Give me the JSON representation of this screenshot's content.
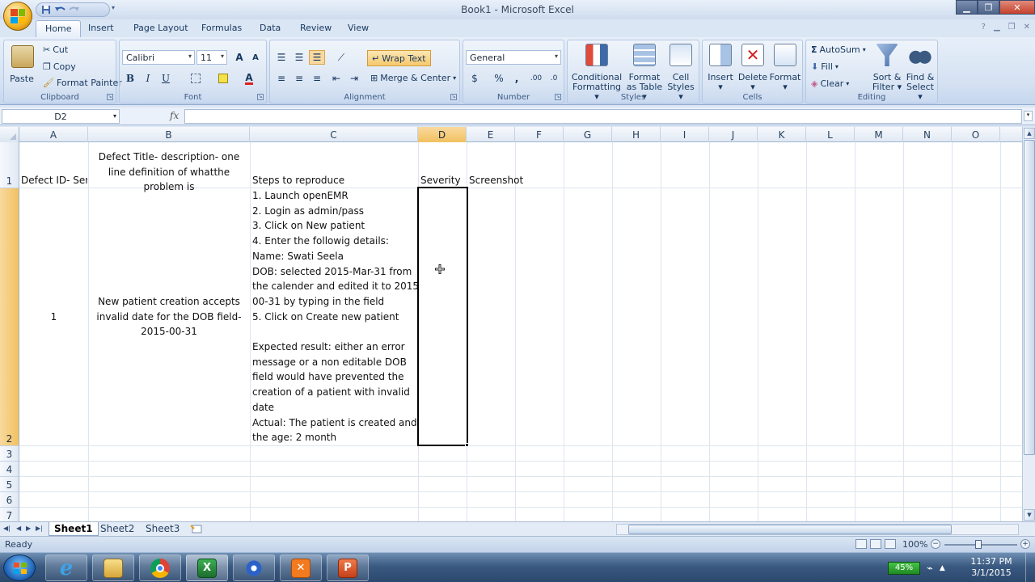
{
  "window": {
    "title": "Book1 - Microsoft Excel",
    "controls": {
      "minimize": "▁",
      "restore": "❐",
      "close": "✕"
    }
  },
  "ribbon_tabs": [
    "Home",
    "Insert",
    "Page Layout",
    "Formulas",
    "Data",
    "Review",
    "View"
  ],
  "active_tab": "Home",
  "ribbon": {
    "clipboard": {
      "label": "Clipboard",
      "paste": "Paste",
      "cut": "Cut",
      "copy": "Copy",
      "format_painter": "Format Painter"
    },
    "font": {
      "label": "Font",
      "name": "Calibri",
      "size": "11",
      "bold": "B",
      "italic": "I",
      "underline": "U",
      "grow": "A",
      "shrink": "A"
    },
    "alignment": {
      "label": "Alignment",
      "wrap_text": "Wrap Text",
      "merge_center": "Merge & Center"
    },
    "number": {
      "label": "Number",
      "format": "General",
      "currency": "$",
      "percent": "%",
      "comma": ",",
      "inc_dec": ".00",
      "dec_dec": ".0"
    },
    "styles": {
      "label": "Styles",
      "conditional_formatting_1": "Conditional",
      "conditional_formatting_2": "Formatting",
      "format_as_table_1": "Format",
      "format_as_table_2": "as Table",
      "cell_styles_1": "Cell",
      "cell_styles_2": "Styles"
    },
    "cells": {
      "label": "Cells",
      "insert": "Insert",
      "delete": "Delete",
      "format": "Format"
    },
    "editing": {
      "label": "Editing",
      "autosum": "AutoSum",
      "fill": "Fill",
      "clear": "Clear",
      "sort_filter_1": "Sort &",
      "sort_filter_2": "Filter",
      "find_select_1": "Find &",
      "find_select_2": "Select"
    }
  },
  "formula_bar": {
    "name_box": "D2",
    "fx": "fx",
    "formula": ""
  },
  "columns": [
    "A",
    "B",
    "C",
    "D",
    "E",
    "F",
    "G",
    "H",
    "I",
    "J",
    "K",
    "L",
    "M",
    "N",
    "O"
  ],
  "rows": [
    "1",
    "2",
    "3",
    "4",
    "5",
    "6",
    "7"
  ],
  "selected_cell": "D2",
  "cells": {
    "A1": "Defect ID- Serial",
    "B1": "Defect Title- description- one line definition of whatthe problem is",
    "C1": "Steps to reproduce",
    "D1": "Severity",
    "E1": "Screenshot",
    "A2": "1",
    "B2": "New patient creation accepts invalid date for the DOB field- 2015-00-31",
    "C2_lines": [
      "1. Launch openEMR",
      "2. Login as admin/pass",
      "3. Click on New patient",
      "4. Enter the followig details:",
      "Name: Swati Seela",
      "DOB: selected 2015-Mar-31 from",
      "the calender and edited it to 2015-",
      "00-31 by typing in the field",
      "5. Click on Create new patient",
      "",
      "Expected result: either an error",
      "message or a non editable DOB",
      "field would have prevented the",
      "creation of a patient with invalid",
      "date",
      "Actual: The patient is created and",
      "the age: 2 month"
    ]
  },
  "sheets": [
    "Sheet1",
    "Sheet2",
    "Sheet3"
  ],
  "active_sheet": "Sheet1",
  "status": {
    "text": "Ready",
    "zoom": "100%"
  },
  "taskbar": {
    "apps": [
      "internet-explorer",
      "file-explorer",
      "chrome",
      "excel",
      "snipping-tool",
      "xampp",
      "powerpoint"
    ],
    "battery": "45%",
    "time": "11:37 PM",
    "date": "3/1/2015"
  },
  "colors": {
    "selection_header": "#f1c15f",
    "ribbon": "#d4e1f2",
    "taskbar": "#3b5a82"
  }
}
